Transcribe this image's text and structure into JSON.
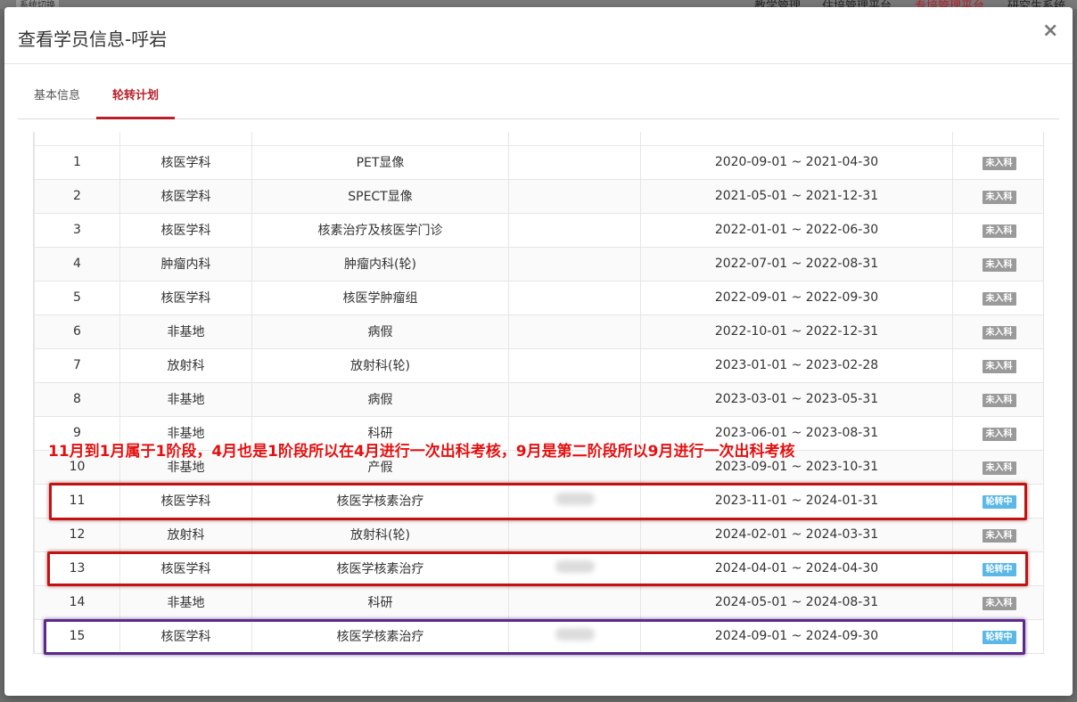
{
  "background": {
    "nav": [
      "教学管理",
      "住培管理平台",
      "专培管理平台",
      "研究生系统"
    ],
    "left_label": "系统切换"
  },
  "modal": {
    "title": "查看学员信息-呼岩",
    "close": "×"
  },
  "tabs": [
    {
      "label": "基本信息",
      "active": false
    },
    {
      "label": "轮转计划",
      "active": true
    }
  ],
  "rows": [
    {
      "no": "1",
      "dept": "核医学科",
      "sub": "PET显像",
      "teacher": "",
      "period": "2020-09-01 ~ 2021-04-30",
      "status": "未入科"
    },
    {
      "no": "2",
      "dept": "核医学科",
      "sub": "SPECT显像",
      "teacher": "",
      "period": "2021-05-01 ~ 2021-12-31",
      "status": "未入科"
    },
    {
      "no": "3",
      "dept": "核医学科",
      "sub": "核素治疗及核医学门诊",
      "teacher": "",
      "period": "2022-01-01 ~ 2022-06-30",
      "status": "未入科"
    },
    {
      "no": "4",
      "dept": "肿瘤内科",
      "sub": "肿瘤内科(轮)",
      "teacher": "",
      "period": "2022-07-01 ~ 2022-08-31",
      "status": "未入科"
    },
    {
      "no": "5",
      "dept": "核医学科",
      "sub": "核医学肿瘤组",
      "teacher": "",
      "period": "2022-09-01 ~ 2022-09-30",
      "status": "未入科"
    },
    {
      "no": "6",
      "dept": "非基地",
      "sub": "病假",
      "teacher": "",
      "period": "2022-10-01 ~ 2022-12-31",
      "status": "未入科"
    },
    {
      "no": "7",
      "dept": "放射科",
      "sub": "放射科(轮)",
      "teacher": "",
      "period": "2023-01-01 ~ 2023-02-28",
      "status": "未入科"
    },
    {
      "no": "8",
      "dept": "非基地",
      "sub": "病假",
      "teacher": "",
      "period": "2023-03-01 ~ 2023-05-31",
      "status": "未入科"
    },
    {
      "no": "9",
      "dept": "非基地",
      "sub": "科研",
      "teacher": "",
      "period": "2023-06-01 ~ 2023-08-31",
      "status": "未入科"
    },
    {
      "no": "10",
      "dept": "非基地",
      "sub": "产假",
      "teacher": "",
      "period": "2023-09-01 ~ 2023-10-31",
      "status": "未入科"
    },
    {
      "no": "11",
      "dept": "核医学科",
      "sub": "核医学核素治疗",
      "teacher": "blurred",
      "period": "2023-11-01 ~ 2024-01-31",
      "status": "轮转中"
    },
    {
      "no": "12",
      "dept": "放射科",
      "sub": "放射科(轮)",
      "teacher": "",
      "period": "2024-02-01 ~ 2024-03-31",
      "status": "未入科"
    },
    {
      "no": "13",
      "dept": "核医学科",
      "sub": "核医学核素治疗",
      "teacher": "blurred",
      "period": "2024-04-01 ~ 2024-04-30",
      "status": "轮转中"
    },
    {
      "no": "14",
      "dept": "非基地",
      "sub": "科研",
      "teacher": "",
      "period": "2024-05-01 ~ 2024-08-31",
      "status": "未入科"
    },
    {
      "no": "15",
      "dept": "核医学科",
      "sub": "核医学核素治疗",
      "teacher": "blurred",
      "period": "2024-09-01 ~ 2024-09-30",
      "status": "轮转中"
    }
  ],
  "annotation": "11月到1月属于1阶段，4月也是1阶段所以在4月进行一次出科考核，9月是第二阶段所以9月进行一次出科考核",
  "colors": {
    "accent": "#b8202a",
    "status_pending": "#9a9a9a",
    "status_active": "#5bb8e6",
    "highlight_red": "#c21212",
    "highlight_purple": "#5b2a8a"
  }
}
